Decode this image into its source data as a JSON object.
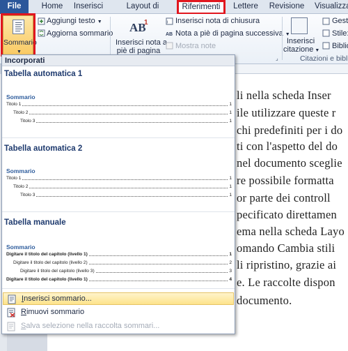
{
  "tabs": {
    "file": "File",
    "home": "Home",
    "insert": "Inserisci",
    "layout": "Layout di pagina",
    "references": "Riferimenti",
    "mailings": "Lettere",
    "review": "Revisione",
    "view": "Visualizza"
  },
  "ribbon": {
    "toc_button": "Sommario",
    "add_text": "Aggiungi testo",
    "update_toc": "Aggiorna sommario",
    "insert_footnote_line1": "Inserisci nota a",
    "insert_footnote_line2": "piè di pagina",
    "insert_endnote": "Inserisci nota di chiusura",
    "next_footnote": "Nota a piè di pagina successiva",
    "show_notes": "Mostra note",
    "insert_citation_line1": "Inserisci",
    "insert_citation_line2": "citazione",
    "citations_group": "Citazioni e bibli",
    "manage_sources": "Gesti",
    "style": "Stile:",
    "bibliography": "Biblio",
    "ab_glyph": "AB",
    "ab_sup": "1"
  },
  "menu": {
    "header": "Incorporati",
    "galleries": [
      {
        "title": "Tabella automatica 1",
        "toc_heading": "Sommario",
        "rows": [
          {
            "label": "Titolo 1",
            "page": "1"
          },
          {
            "label": "Titolo 2",
            "page": "1"
          },
          {
            "label": "Titolo 3",
            "page": "1"
          }
        ]
      },
      {
        "title": "Tabella automatica 2",
        "toc_heading": "Sommario",
        "rows": [
          {
            "label": "Titolo 1",
            "page": "1"
          },
          {
            "label": "Titolo 2",
            "page": "1"
          },
          {
            "label": "Titolo 3",
            "page": "1"
          }
        ]
      },
      {
        "title": "Tabella manuale",
        "toc_heading": "Sommario",
        "rows": [
          {
            "label": "Digitare il titolo del capitolo (livello 1)",
            "page": "1"
          },
          {
            "label": "Digitare il titolo del capitolo (livello 2)",
            "page": "2"
          },
          {
            "label": "Digitare il titolo del capitolo (livello 3)",
            "page": "3"
          },
          {
            "label": "Digitare il titolo del capitolo (livello 1)",
            "page": "4"
          }
        ]
      }
    ],
    "commands": {
      "insert_toc": "Inserisci sommario...",
      "remove_toc": "Rimuovi sommario",
      "save_selection": "Salva selezione nella raccolta sommari..."
    }
  },
  "document": {
    "lines": [
      "li nella scheda Inser",
      "ile utilizzare queste r",
      "chi predefiniti per i do",
      "ti con l'aspetto del do",
      "nel documento sceglie",
      "re possibile formatta",
      "or parte dei controll",
      "pecificato direttamen",
      "ema nella scheda Layo",
      "omando Cambia stili",
      "li ripristino, grazie ai",
      "e. Le raccolte dispon",
      "documento."
    ]
  },
  "colors": {
    "accent": "#2b579a",
    "highlight_red": "#e1161e",
    "hover_yellow": "#fde38b"
  }
}
